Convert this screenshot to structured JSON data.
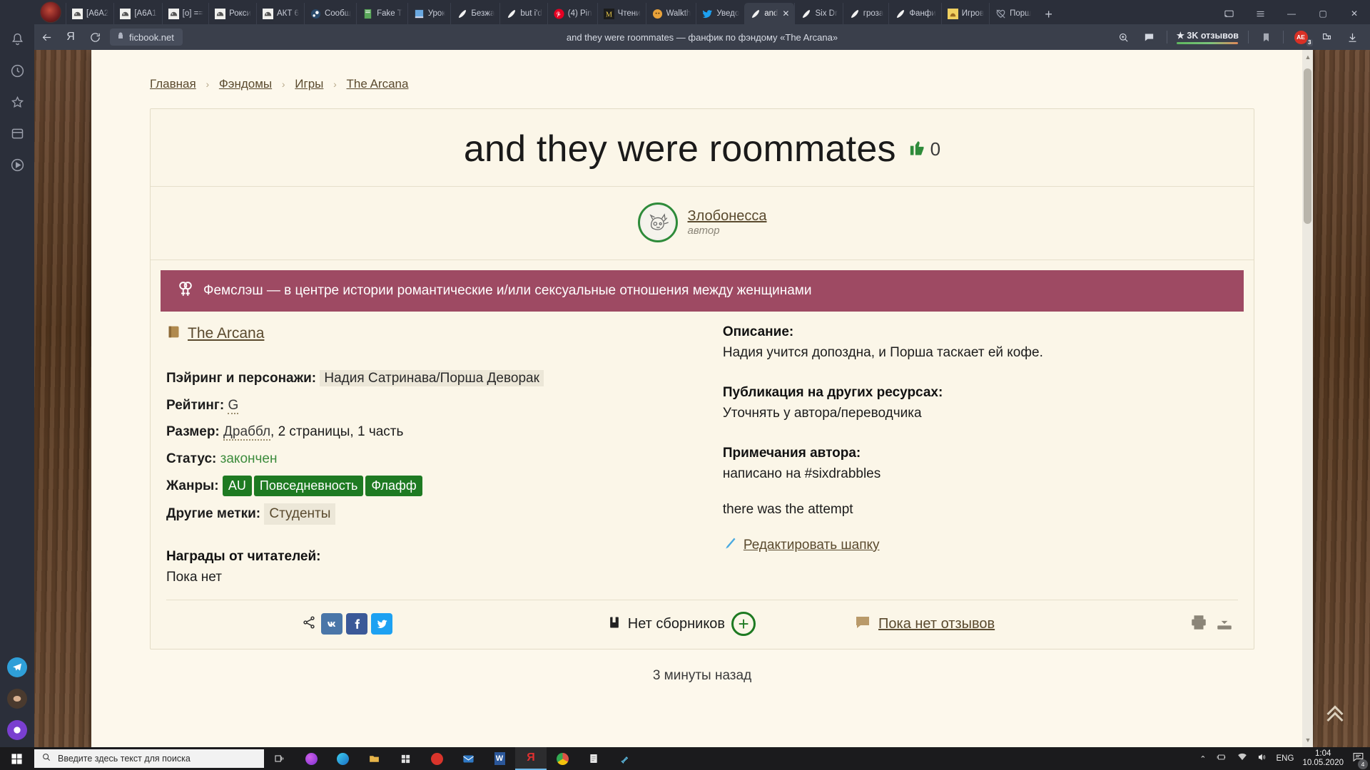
{
  "browser": {
    "name": "yandex-browser",
    "tabs": [
      {
        "label": "[А6А2",
        "icon": "ficbook-cat-icon",
        "active": false
      },
      {
        "label": "[А6А1",
        "icon": "ficbook-cat-icon",
        "active": false
      },
      {
        "label": "[o] ==",
        "icon": "ficbook-cat-icon",
        "active": false
      },
      {
        "label": "Рокси",
        "icon": "ficbook-cat-icon",
        "active": false
      },
      {
        "label": "АКТ 6",
        "icon": "ficbook-cat-icon",
        "active": false
      },
      {
        "label": "Сообщ",
        "icon": "steam-icon",
        "active": false
      },
      {
        "label": "Fake T",
        "icon": "document-icon",
        "active": false
      },
      {
        "label": "Урок",
        "icon": "book-blue-icon",
        "active": false
      },
      {
        "label": "Безжа",
        "icon": "feather-icon",
        "active": false
      },
      {
        "label": "but i'd",
        "icon": "feather-icon",
        "active": false
      },
      {
        "label": "(4) Pin",
        "icon": "pinterest-icon",
        "active": false
      },
      {
        "label": "Чтени",
        "icon": "medium-icon",
        "active": false
      },
      {
        "label": "Walkth",
        "icon": "orange-circle-icon",
        "active": false
      },
      {
        "label": "Уведо",
        "icon": "twitter-icon",
        "active": false
      },
      {
        "label": "and",
        "icon": "feather-icon",
        "active": true
      },
      {
        "label": "Six Dr",
        "icon": "feather-icon",
        "active": false
      },
      {
        "label": "гроза",
        "icon": "feather-icon",
        "active": false
      },
      {
        "label": "Фанфи",
        "icon": "feather-icon",
        "active": false
      },
      {
        "label": "Игров",
        "icon": "cat-yellow-icon",
        "active": false
      },
      {
        "label": "Порш",
        "icon": "heart-off-icon",
        "active": false
      }
    ],
    "new_tab_label": "+",
    "url": "ficbook.net",
    "page_title": "and they were roommates — фанфик по фэндому «The Arcana»",
    "reviews_badge": "★ 3K отзывов",
    "adguard_label": "AE",
    "adguard_count": "3",
    "window_controls": {
      "minimize": "—",
      "maximize": "▢",
      "close": "✕"
    }
  },
  "breadcrumb": [
    {
      "label": "Главная"
    },
    {
      "label": "Фэндомы"
    },
    {
      "label": "Игры"
    },
    {
      "label": "The Arcana"
    }
  ],
  "breadcrumb_separator": "›",
  "fic": {
    "title": "and they were roommates",
    "like_count": "0",
    "author_name": "Злобонесса",
    "author_role": "автор",
    "warning": "Фемслэш — в центре истории романтические и/или сексуальные отношения между женщинами",
    "fandom": "The Arcana",
    "left_meta": [
      {
        "label": "Пэйринг и персонажи:",
        "value": "Надия Сатринава/Порша Деворак",
        "style": "chip"
      },
      {
        "label": "Рейтинг:",
        "value": "G",
        "style": "dotted"
      },
      {
        "label": "Размер:",
        "value": "Драббл",
        "value2": ", 2 страницы, 1 часть",
        "style": "dotted-plus"
      },
      {
        "label": "Статус:",
        "value": "закончен",
        "style": "green"
      },
      {
        "label": "Жанры:",
        "genres": [
          "AU",
          "Повседневность",
          "Флафф"
        ],
        "style": "genres"
      },
      {
        "label": "Другие метки:",
        "tags": [
          "Студенты"
        ],
        "style": "tags"
      }
    ],
    "awards_heading": "Награды от читателей:",
    "awards_value": "Пока нет",
    "right_blocks": [
      {
        "heading": "Описание:",
        "body": "Надия учится допоздна, и Порша таскает ей кофе."
      },
      {
        "heading": "Публикация на других ресурсах:",
        "body": "Уточнять у автора/переводчика"
      },
      {
        "heading": "Примечания автора:",
        "body": "написано на #sixdrabbles",
        "body2": "there was the attempt"
      }
    ],
    "edit_link": "Редактировать шапку"
  },
  "actionbar": {
    "share_icon": "share-icon",
    "social": [
      {
        "name": "vk",
        "label": "vk",
        "color": "#4a76a8"
      },
      {
        "name": "facebook",
        "label": "f",
        "color": "#3b5998"
      },
      {
        "name": "twitter",
        "label": "t",
        "color": "#1da1f2"
      }
    ],
    "collections_label": "Нет сборников",
    "add_label": "+",
    "reviews_label": "Пока нет отзывов",
    "print_icon": "print-icon",
    "download_icon": "download-icon"
  },
  "time_ago": "3 минуты назад",
  "taskbar": {
    "search_placeholder": "Введите здесь текст для поиска",
    "apps": [
      {
        "name": "task-view",
        "icon": "task-view-icon"
      },
      {
        "name": "cortana",
        "icon": "cortana-icon"
      },
      {
        "name": "edge",
        "icon": "edge-icon"
      },
      {
        "name": "explorer",
        "icon": "folder-icon"
      },
      {
        "name": "store",
        "icon": "store-icon"
      },
      {
        "name": "opera",
        "icon": "opera-icon"
      },
      {
        "name": "mail",
        "icon": "mail-icon"
      },
      {
        "name": "word",
        "icon": "word-icon"
      },
      {
        "name": "yandex",
        "icon": "yandex-icon"
      },
      {
        "name": "chrome",
        "icon": "chrome-icon"
      },
      {
        "name": "reader",
        "icon": "reader-icon"
      },
      {
        "name": "paint",
        "icon": "paint-icon"
      }
    ],
    "language": "ENG",
    "time": "1:04",
    "date": "10.05.2020",
    "notification_count": "4"
  },
  "colors": {
    "accent_green": "#1e7a22",
    "warning_bg": "#9e4a63",
    "page_bg": "#fbf6e8",
    "brown_link": "#5a4a2e",
    "browser_chrome": "#3a3f4b"
  }
}
